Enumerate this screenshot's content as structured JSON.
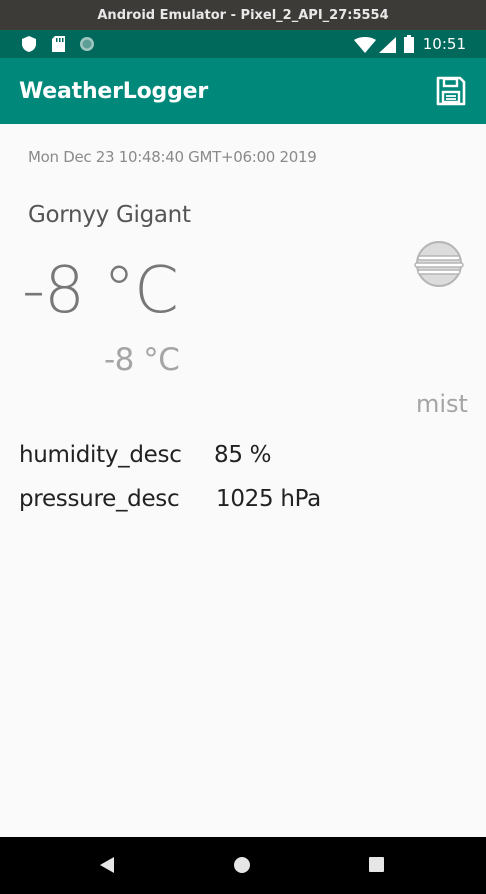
{
  "window": {
    "title": "Android Emulator - Pixel_2_API_27:5554"
  },
  "status_bar": {
    "time": "10:51"
  },
  "app_bar": {
    "title": "WeatherLogger",
    "save_icon": "save-icon"
  },
  "weather": {
    "datetime": "Mon Dec 23 10:48:40 GMT+06:00 2019",
    "city": "Gornyy Gigant",
    "temperature": "-8 °C",
    "feels_like": "-8 °C",
    "icon": "mist-icon",
    "description": "mist",
    "humidity_label": "humidity_desc",
    "humidity_value": "85 %",
    "pressure_label": "pressure_desc",
    "pressure_value": "1025 hPa"
  },
  "colors": {
    "status_bar": "#00695c",
    "app_bar": "#00897b",
    "background": "#fafafa"
  }
}
